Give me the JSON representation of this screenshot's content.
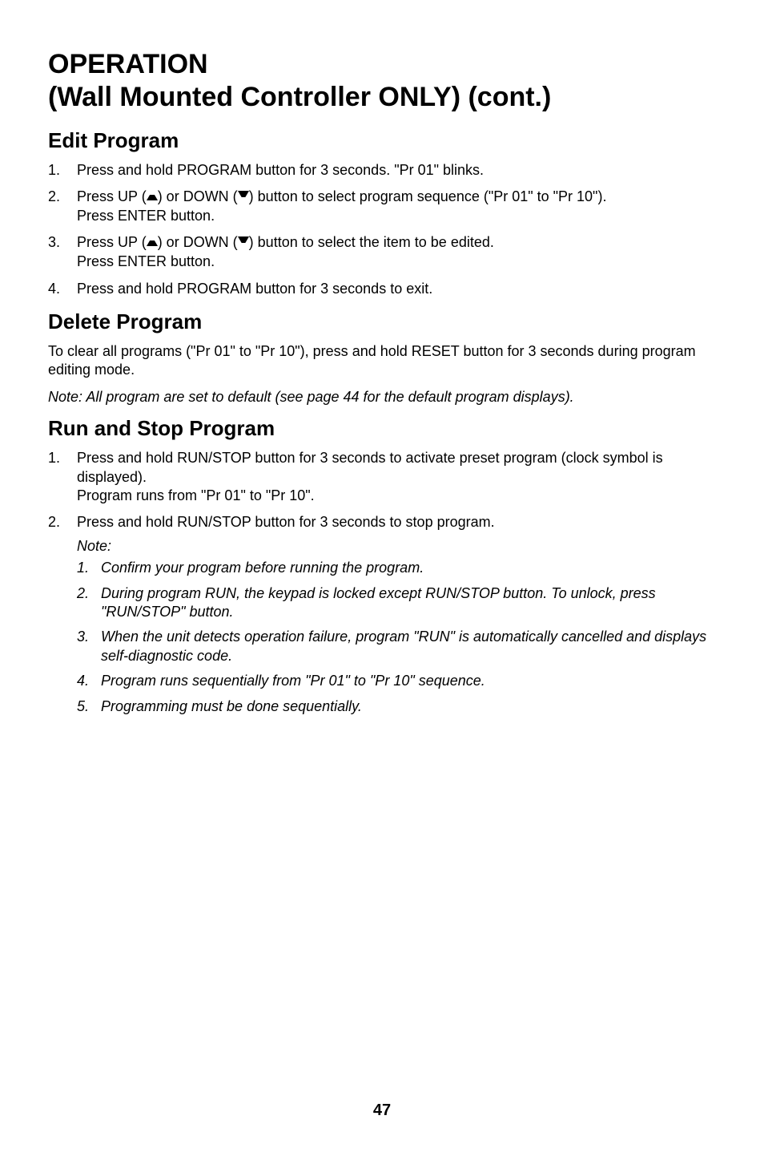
{
  "title_line1": "OPERATION",
  "title_line2": "(Wall Mounted Controller ONLY) (cont.)",
  "edit_program": {
    "heading": "Edit Program",
    "items": [
      {
        "num": "1.",
        "text": "Press and hold PROGRAM button for 3 seconds. \"Pr 01\" blinks."
      },
      {
        "num": "2.",
        "text_before": "Press UP (",
        "text_mid": ") or DOWN (",
        "text_after": ") button to select program sequence (\"Pr 01\" to \"Pr 10\").",
        "line2": "Press ENTER button."
      },
      {
        "num": "3.",
        "text_before": "Press UP (",
        "text_mid": ") or DOWN (",
        "text_after": ") button to select the item to be edited.",
        "line2": "Press ENTER button."
      },
      {
        "num": "4.",
        "text": "Press and hold PROGRAM button for 3 seconds to exit."
      }
    ]
  },
  "delete_program": {
    "heading": "Delete Program",
    "para1": "To clear all programs (\"Pr 01\" to \"Pr 10\"), press and hold RESET button for 3 seconds during program editing mode.",
    "note": "Note: All program are set to default (see page 44 for the default program displays)."
  },
  "run_stop": {
    "heading": "Run and Stop Program",
    "items": [
      {
        "num": "1.",
        "line1": "Press and hold RUN/STOP button for 3 seconds to activate preset program (clock symbol is displayed).",
        "line2": "Program runs from \"Pr 01\" to \"Pr 10\"."
      },
      {
        "num": "2.",
        "line1": "Press and hold RUN/STOP button for 3 seconds to stop program.",
        "note_label": "Note:",
        "notes": [
          {
            "subnum": "1.",
            "text": "Confirm your program before running the program."
          },
          {
            "subnum": "2.",
            "text": "During program RUN, the keypad is locked except RUN/STOP button. To unlock, press \"RUN/STOP\" button."
          },
          {
            "subnum": "3.",
            "text": "When the unit detects operation failure, program \"RUN\" is automatically cancelled and displays self-diagnostic code."
          },
          {
            "subnum": "4.",
            "text": "Program runs sequentially from \"Pr 01\" to \"Pr 10\" sequence."
          },
          {
            "subnum": "5.",
            "text": "Programming must be done sequentially."
          }
        ]
      }
    ]
  },
  "page_number": "47"
}
